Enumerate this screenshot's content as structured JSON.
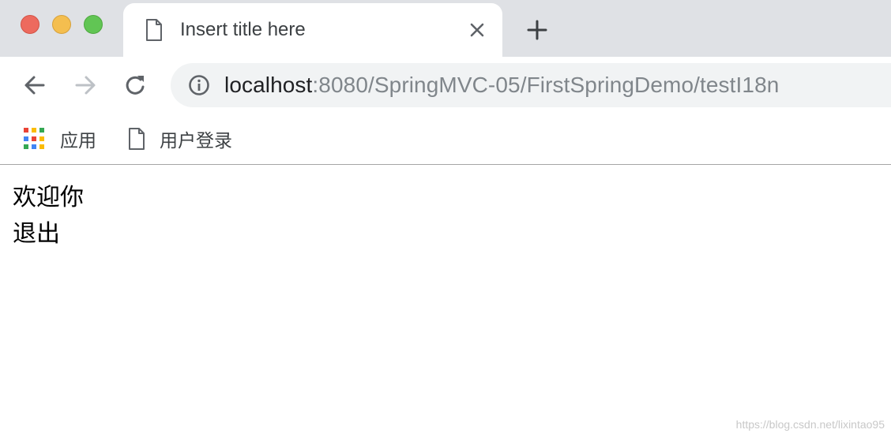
{
  "window": {
    "controls": [
      "close",
      "minimize",
      "maximize"
    ],
    "colors": {
      "close": "#ed6a5e",
      "minimize": "#f4be4f",
      "maximize": "#61c554"
    }
  },
  "tab": {
    "title": "Insert title here",
    "icon": "document-icon",
    "close_icon": "close-icon"
  },
  "newtab": {
    "icon": "plus-icon"
  },
  "toolbar": {
    "back_icon": "arrow-left-icon",
    "forward_icon": "arrow-right-icon",
    "reload_icon": "reload-icon",
    "site_info_icon": "info-icon",
    "url_host": "localhost",
    "url_rest": ":8080/SpringMVC-05/FirstSpringDemo/testI18n"
  },
  "bookmarks": [
    {
      "label": "应用",
      "icon": "apps-grid-icon"
    },
    {
      "label": "用户登录",
      "icon": "document-icon"
    }
  ],
  "content": {
    "welcome": "欢迎你",
    "logout": "退出"
  },
  "watermark": "https://blog.csdn.net/lixintao95",
  "apps_icon_colors": [
    "#ea4335",
    "#fbbc05",
    "#34a853",
    "#4285f4",
    "#ea4335",
    "#fbbc05",
    "#34a853",
    "#4285f4",
    "#fbbc05"
  ]
}
